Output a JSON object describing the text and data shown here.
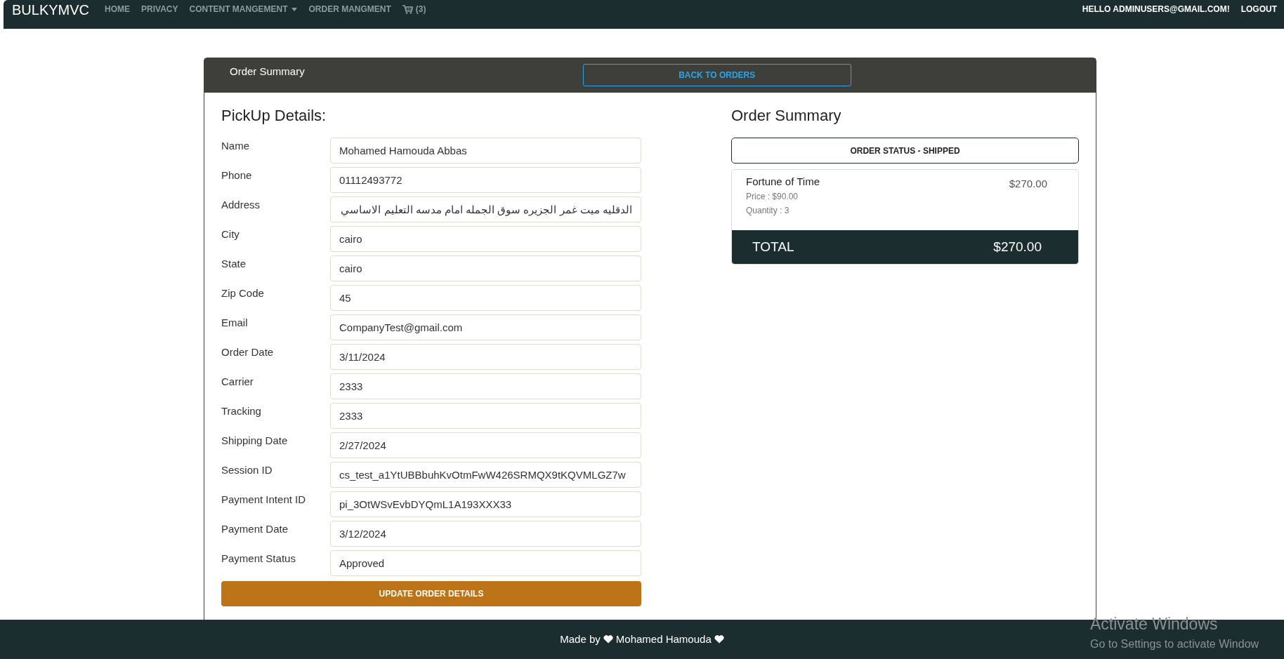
{
  "navbar": {
    "brand": "BULKYMVC",
    "links": [
      {
        "label": "HOME",
        "kind": "link"
      },
      {
        "label": "PRIVACY",
        "kind": "link"
      },
      {
        "label": "CONTENT MANGEMENT",
        "kind": "dropdown"
      },
      {
        "label": "ORDER MANGMENT",
        "kind": "link"
      },
      {
        "label": "(3)",
        "kind": "cart"
      }
    ],
    "right_links": [
      "HELLO ADMINUSERS@GMAIL.COM!",
      "LOGOUT"
    ]
  },
  "card_header": {
    "title": "Order Summary",
    "back_button": "BACK TO ORDERS"
  },
  "pickup": {
    "title": "PickUp Details:",
    "fields": [
      {
        "label": "Name",
        "value": "Mohamed Hamouda Abbas"
      },
      {
        "label": "Phone",
        "value": "01112493772"
      },
      {
        "label": "Address",
        "value": "الدقليه ميت غمر الجزيره سوق الجمله امام مدسه التعليم الاساسي"
      },
      {
        "label": "City",
        "value": "cairo"
      },
      {
        "label": "State",
        "value": "cairo"
      },
      {
        "label": "Zip Code",
        "value": "45"
      },
      {
        "label": "Email",
        "value": "CompanyTest@gmail.com"
      },
      {
        "label": "Order Date",
        "value": "3/11/2024"
      },
      {
        "label": "Carrier",
        "value": "2333"
      },
      {
        "label": "Tracking",
        "value": "2333"
      },
      {
        "label": "Shipping Date",
        "value": "2/27/2024"
      },
      {
        "label": "Session ID",
        "value": "cs_test_a1YtUBBbuhKvOtmFwW426SRMQX9tKQVMLGZ7w"
      },
      {
        "label": "Payment Intent ID",
        "value": "pi_3OtWSvEvbDYQmL1A193XXX33"
      },
      {
        "label": "Payment Date",
        "value": "3/12/2024"
      },
      {
        "label": "Payment Status",
        "value": "Approved"
      }
    ],
    "update_button": "UPDATE ORDER DETAILS"
  },
  "summary": {
    "title": "Order Summary",
    "status": "ORDER STATUS - SHIPPED",
    "items": [
      {
        "name": "Fortune of Time",
        "price": "Price : $90.00",
        "quantity": "Quantity : 3",
        "total": "$270.00"
      }
    ],
    "total_label": "TOTAL",
    "total_value": "$270.00"
  },
  "footer": {
    "made_by": "Made by",
    "author": "Mohamed Hamouda"
  },
  "os_overlay": {
    "title": "Activate Windows",
    "subtitle": "Go to Settings to activate Window"
  }
}
